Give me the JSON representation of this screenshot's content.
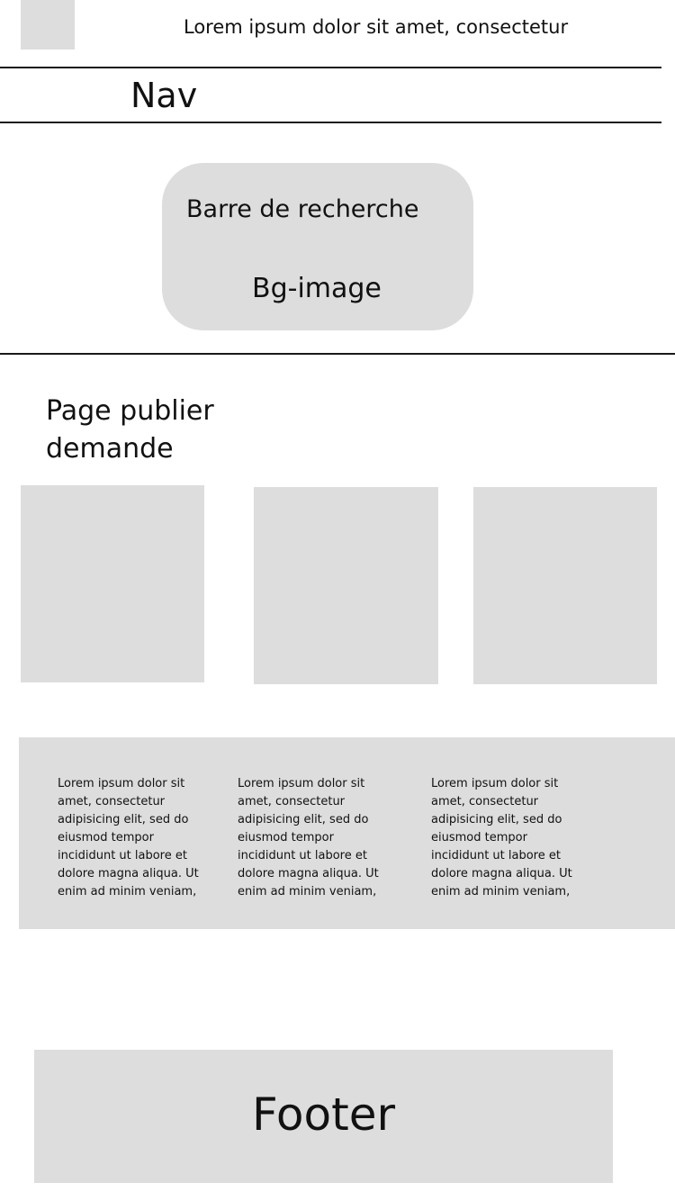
{
  "header": {
    "top_text": "Lorem ipsum dolor sit amet, consectetur",
    "nav_label": "Nav"
  },
  "hero": {
    "search_label": "Barre de recherche",
    "bg_image_label": "Bg-image"
  },
  "main": {
    "title": "Page publier demande",
    "paragraphs": [
      "Lorem ipsum dolor sit amet, consectetur adipisicing elit, sed do eiusmod tempor incididunt ut labore et dolore magna aliqua. Ut enim ad minim veniam,",
      "Lorem ipsum dolor sit amet, consectetur adipisicing elit, sed do eiusmod tempor incididunt ut labore et dolore magna aliqua. Ut enim ad minim veniam,",
      "Lorem ipsum dolor sit amet, consectetur adipisicing elit, sed do eiusmod tempor incididunt ut labore et dolore magna aliqua. Ut enim ad minim veniam,"
    ]
  },
  "footer": {
    "label": "Footer"
  },
  "colors": {
    "placeholder": "#dddddd",
    "divider": "#1a1a1a",
    "text": "#111111",
    "background": "#ffffff"
  }
}
